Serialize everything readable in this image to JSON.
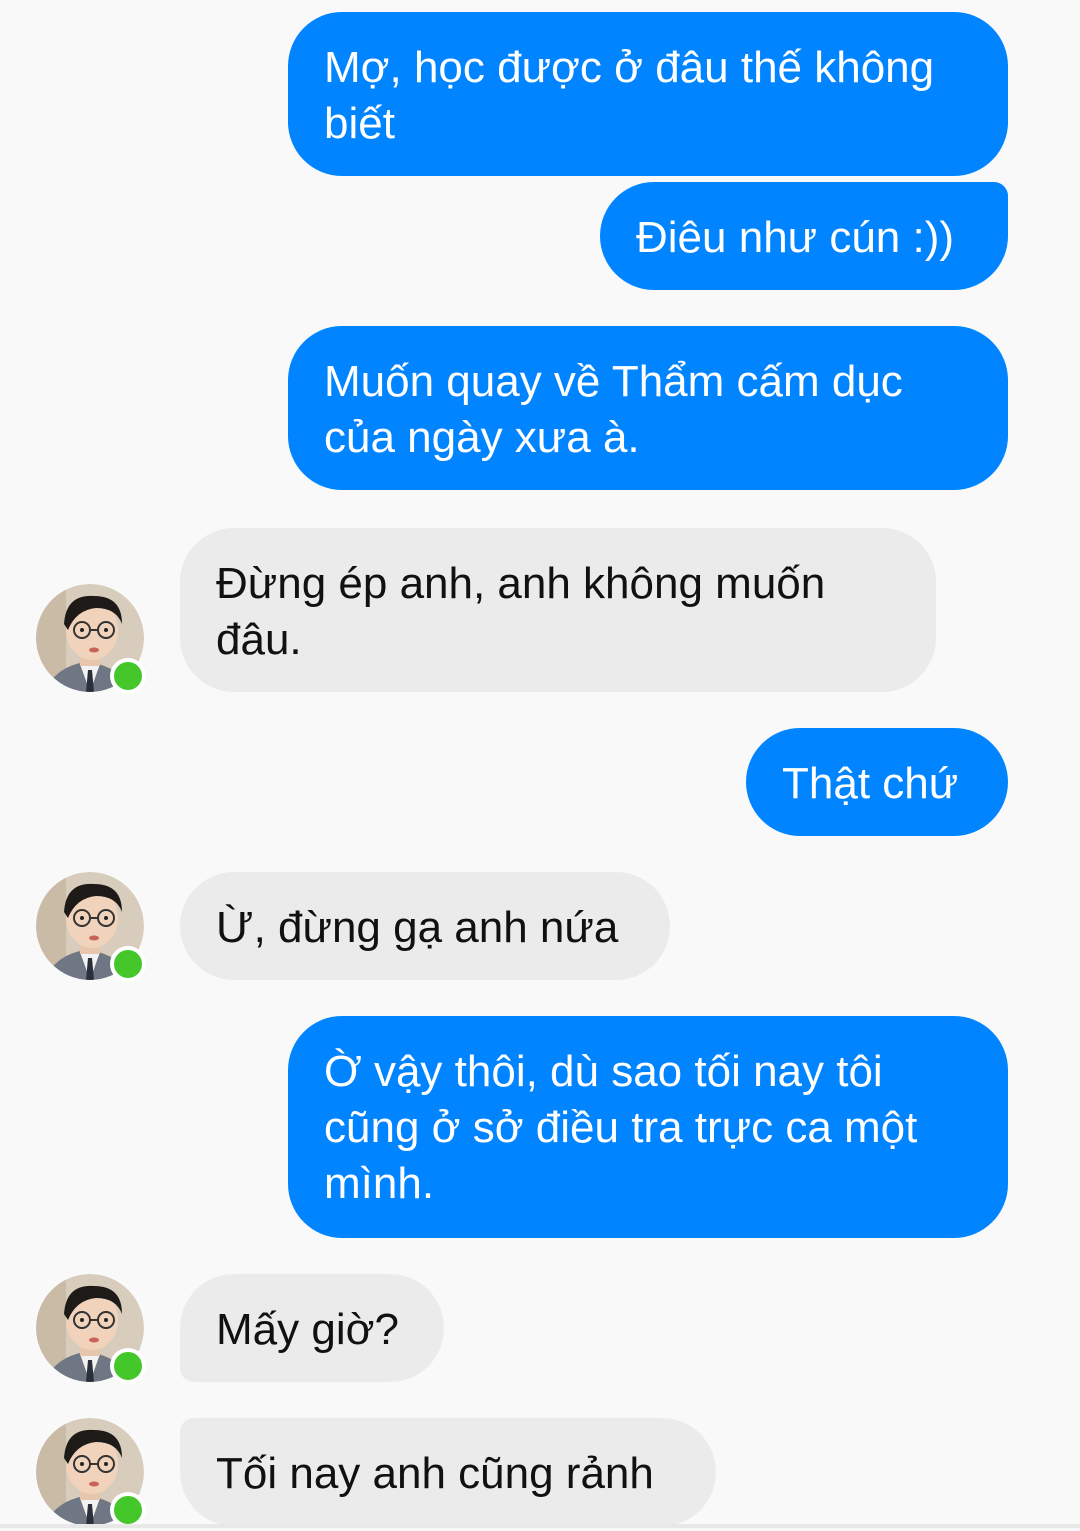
{
  "colors": {
    "outgoing_bubble": "#0084ff",
    "incoming_bubble": "#ebebeb",
    "background": "#f9f9f9",
    "online_dot": "#44c72b"
  },
  "contact": {
    "avatar_icon": "profile-photo-man-with-glasses",
    "status": "online"
  },
  "messages": [
    {
      "direction": "outgoing",
      "text": "Mợ, học được ở đâu thế không\nbiết"
    },
    {
      "direction": "outgoing",
      "text": "Điêu như cún :))"
    },
    {
      "direction": "outgoing",
      "text": "Muốn quay về Thẩm cấm dục\ncủa ngày xưa à."
    },
    {
      "direction": "incoming",
      "text": "Đừng ép anh, anh không muốn\nđâu."
    },
    {
      "direction": "outgoing",
      "text": "Thật chứ"
    },
    {
      "direction": "incoming",
      "text": "Ừ, đừng gạ anh nứa"
    },
    {
      "direction": "outgoing",
      "text": "Ờ vậy thôi, dù sao tối nay tôi\ncũng ở sở điều tra trực ca một\nmình."
    },
    {
      "direction": "incoming",
      "text": "Mấy giờ?"
    },
    {
      "direction": "incoming",
      "text": "Tối nay anh cũng rảnh"
    }
  ]
}
